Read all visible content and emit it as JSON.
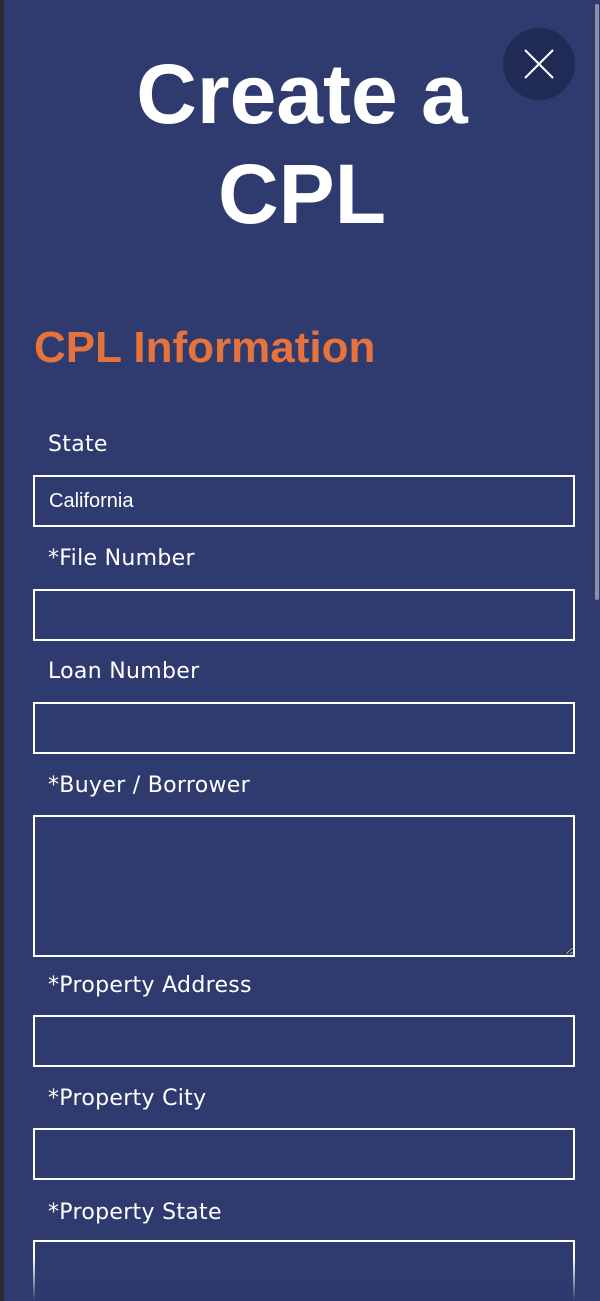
{
  "modal": {
    "title": "Create a\nCPL",
    "section_title": "CPL Information"
  },
  "close_icon": "close-x-icon",
  "colors": {
    "background": "#2f3b6f",
    "accent": "#e6733c",
    "close_button": "#1f2a55",
    "text": "#ffffff"
  },
  "fields": {
    "state": {
      "label": "State",
      "value": "California"
    },
    "file_number": {
      "label": "*File Number",
      "value": ""
    },
    "loan_number": {
      "label": "Loan Number",
      "value": ""
    },
    "buyer_borrower": {
      "label": "*Buyer / Borrower",
      "value": ""
    },
    "property_address": {
      "label": "*Property Address",
      "value": ""
    },
    "property_city": {
      "label": "*Property City",
      "value": ""
    },
    "property_state": {
      "label": "*Property State",
      "value": ""
    }
  }
}
